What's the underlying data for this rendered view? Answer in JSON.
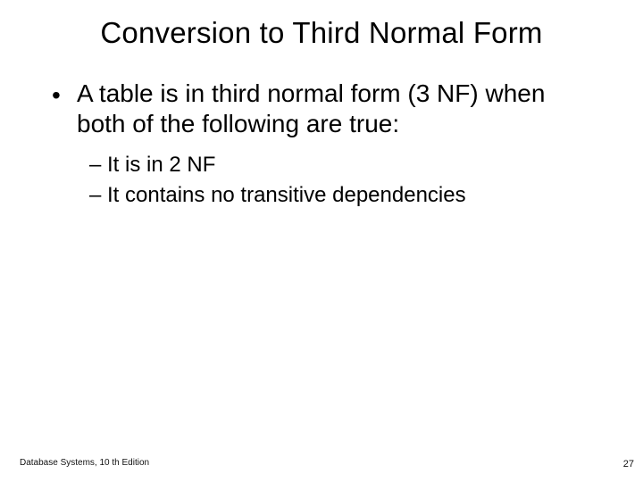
{
  "title": "Conversion to Third Normal Form",
  "bullet": {
    "mark": "•",
    "text": "A table is in third normal form (3 NF) when both of the following are true:"
  },
  "subitems": [
    {
      "dash": "–",
      "text": "It is in 2 NF"
    },
    {
      "dash": "–",
      "text": "It contains no transitive dependencies"
    }
  ],
  "footer": {
    "source": "Database Systems, 10 th Edition",
    "page": "27"
  }
}
